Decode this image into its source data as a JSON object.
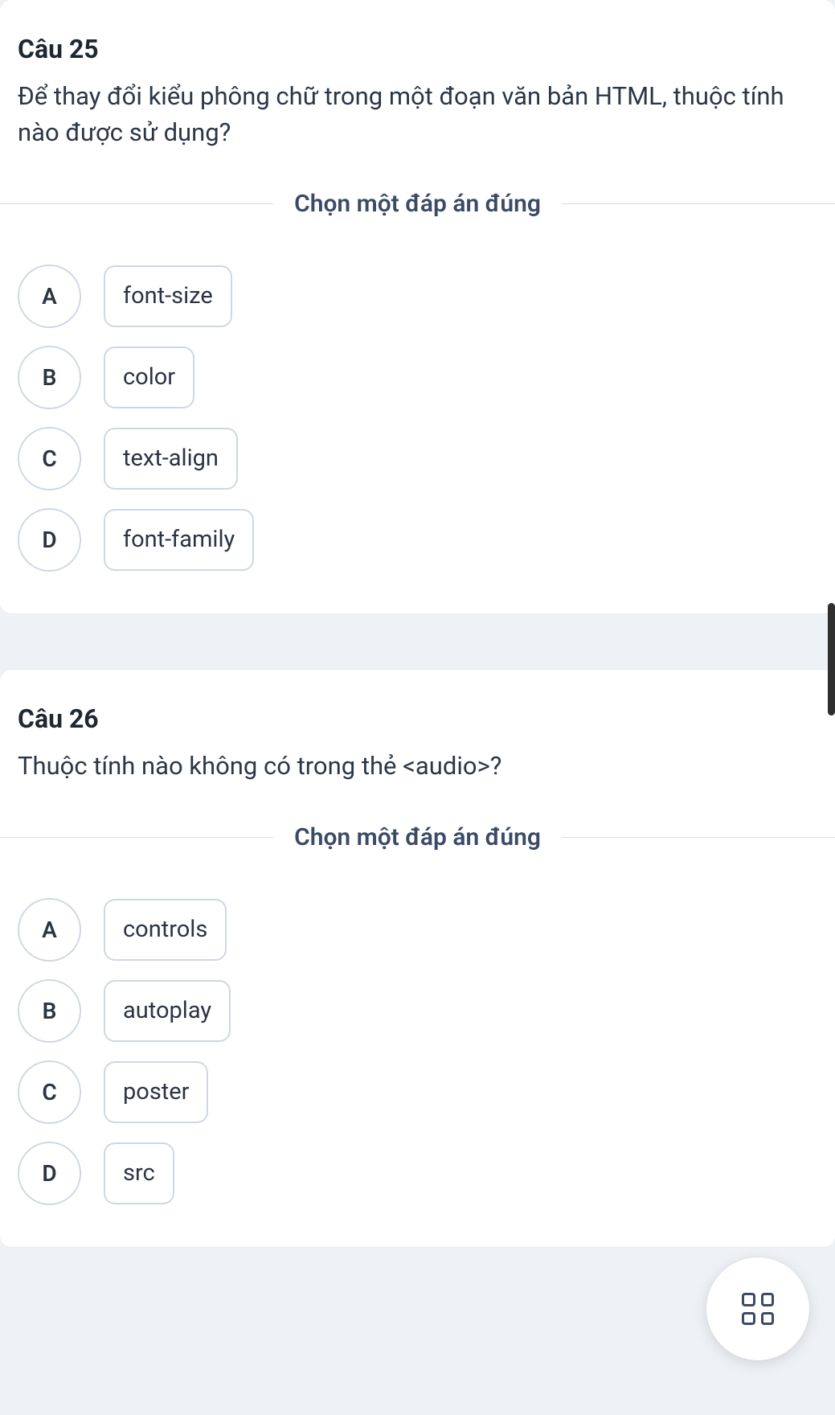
{
  "questions": [
    {
      "title": "Câu 25",
      "text": "Để thay đổi kiểu phông chữ trong một đoạn văn bản HTML, thuộc tính nào được sử dụng?",
      "instruction": "Chọn một đáp án đúng",
      "options": [
        {
          "letter": "A",
          "label": "font-size"
        },
        {
          "letter": "B",
          "label": "color"
        },
        {
          "letter": "C",
          "label": "text-align"
        },
        {
          "letter": "D",
          "label": "font-family"
        }
      ]
    },
    {
      "title": "Câu 26",
      "text": "Thuộc tính nào không có trong thẻ <audio>?",
      "instruction": "Chọn một đáp án đúng",
      "options": [
        {
          "letter": "A",
          "label": "controls"
        },
        {
          "letter": "B",
          "label": "autoplay"
        },
        {
          "letter": "C",
          "label": "poster"
        },
        {
          "letter": "D",
          "label": "src"
        }
      ]
    }
  ]
}
